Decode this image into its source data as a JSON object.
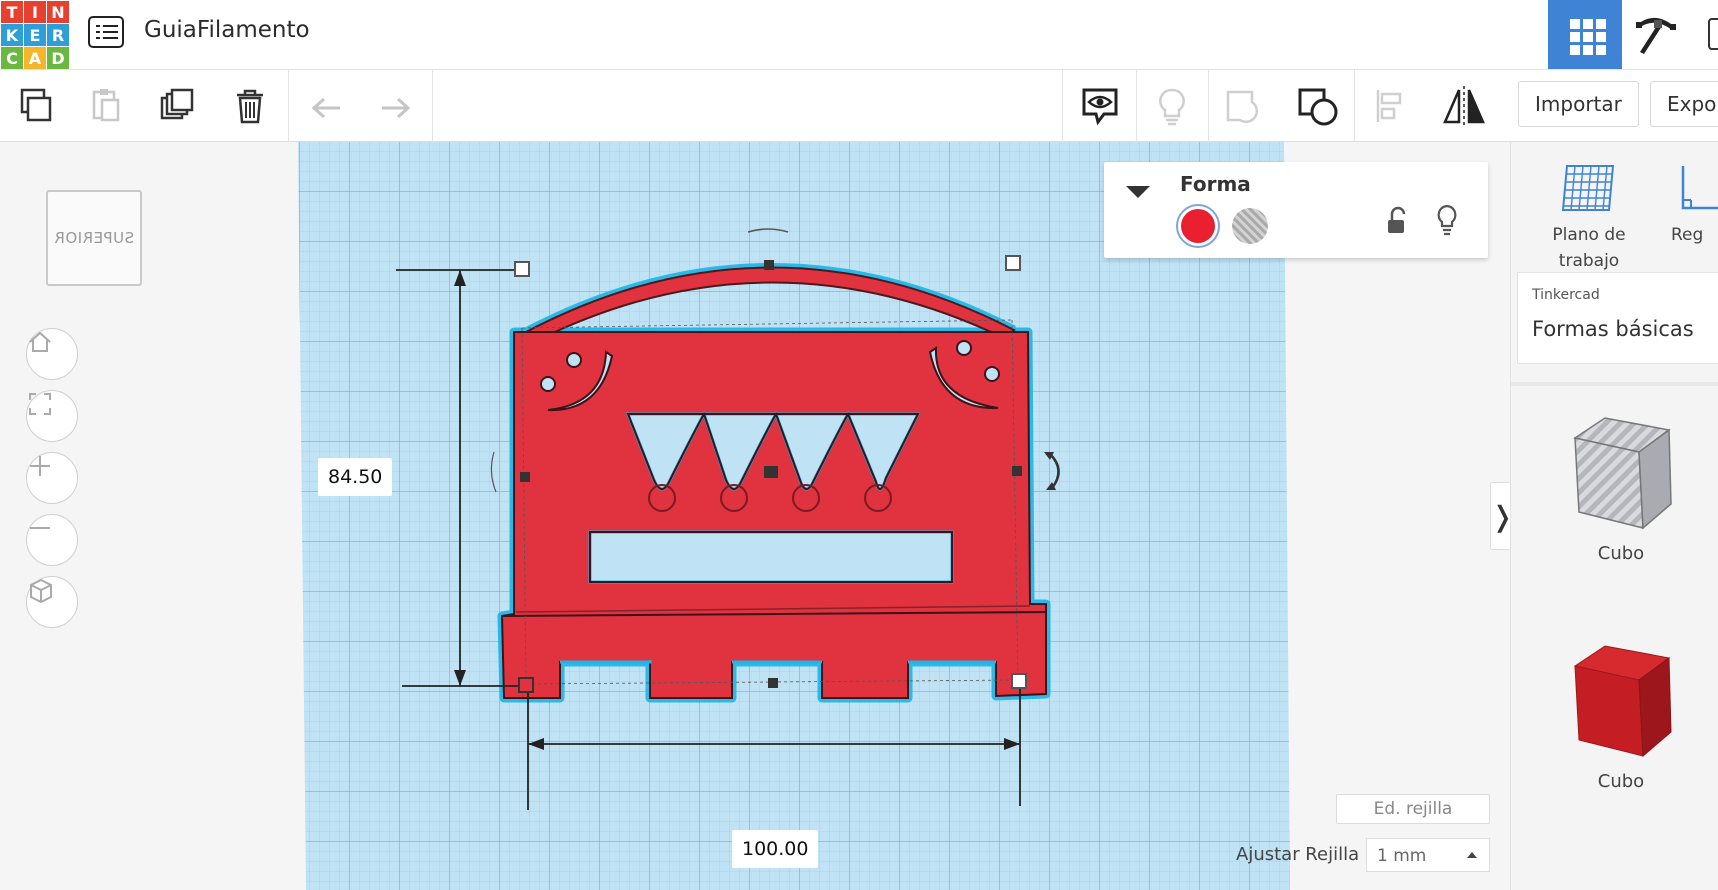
{
  "app": {
    "logo_letters": [
      "T",
      "I",
      "N",
      "K",
      "E",
      "R",
      "C",
      "A",
      "D"
    ],
    "logo_colors": [
      "#e8402f",
      "#e8402f",
      "#e8402f",
      "#2d9ed8",
      "#2d9ed8",
      "#2d9ed8",
      "#6bb841",
      "#f6b62b",
      "#6bb841"
    ],
    "project_title": "GuiaFilamento"
  },
  "toolbar": {
    "import_label": "Importar",
    "export_label": "Expo"
  },
  "canvas": {
    "view_cube_label": "SUPERIOR",
    "height_dimension": "84.50",
    "width_dimension": "100.00",
    "edit_grid_label": "Ed. rejilla",
    "snap_grid_label": "Ajustar Rejilla",
    "snap_grid_value": "1 mm",
    "workplane_color": "#bfe3f5",
    "shape_color": "#e0323f",
    "outline_color": "#1db4e6"
  },
  "shape_panel": {
    "title": "Forma",
    "solid_color": "#e8202f"
  },
  "right_panel": {
    "workplane_label_1": "Plano de",
    "workplane_label_2": "trabajo",
    "ruler_label": "Reg",
    "library_source": "Tinkercad",
    "library_name": "Formas básicas",
    "shapes": [
      {
        "label": "Cubo",
        "style": "hole"
      },
      {
        "label": "Cubo",
        "style": "solid"
      }
    ]
  }
}
